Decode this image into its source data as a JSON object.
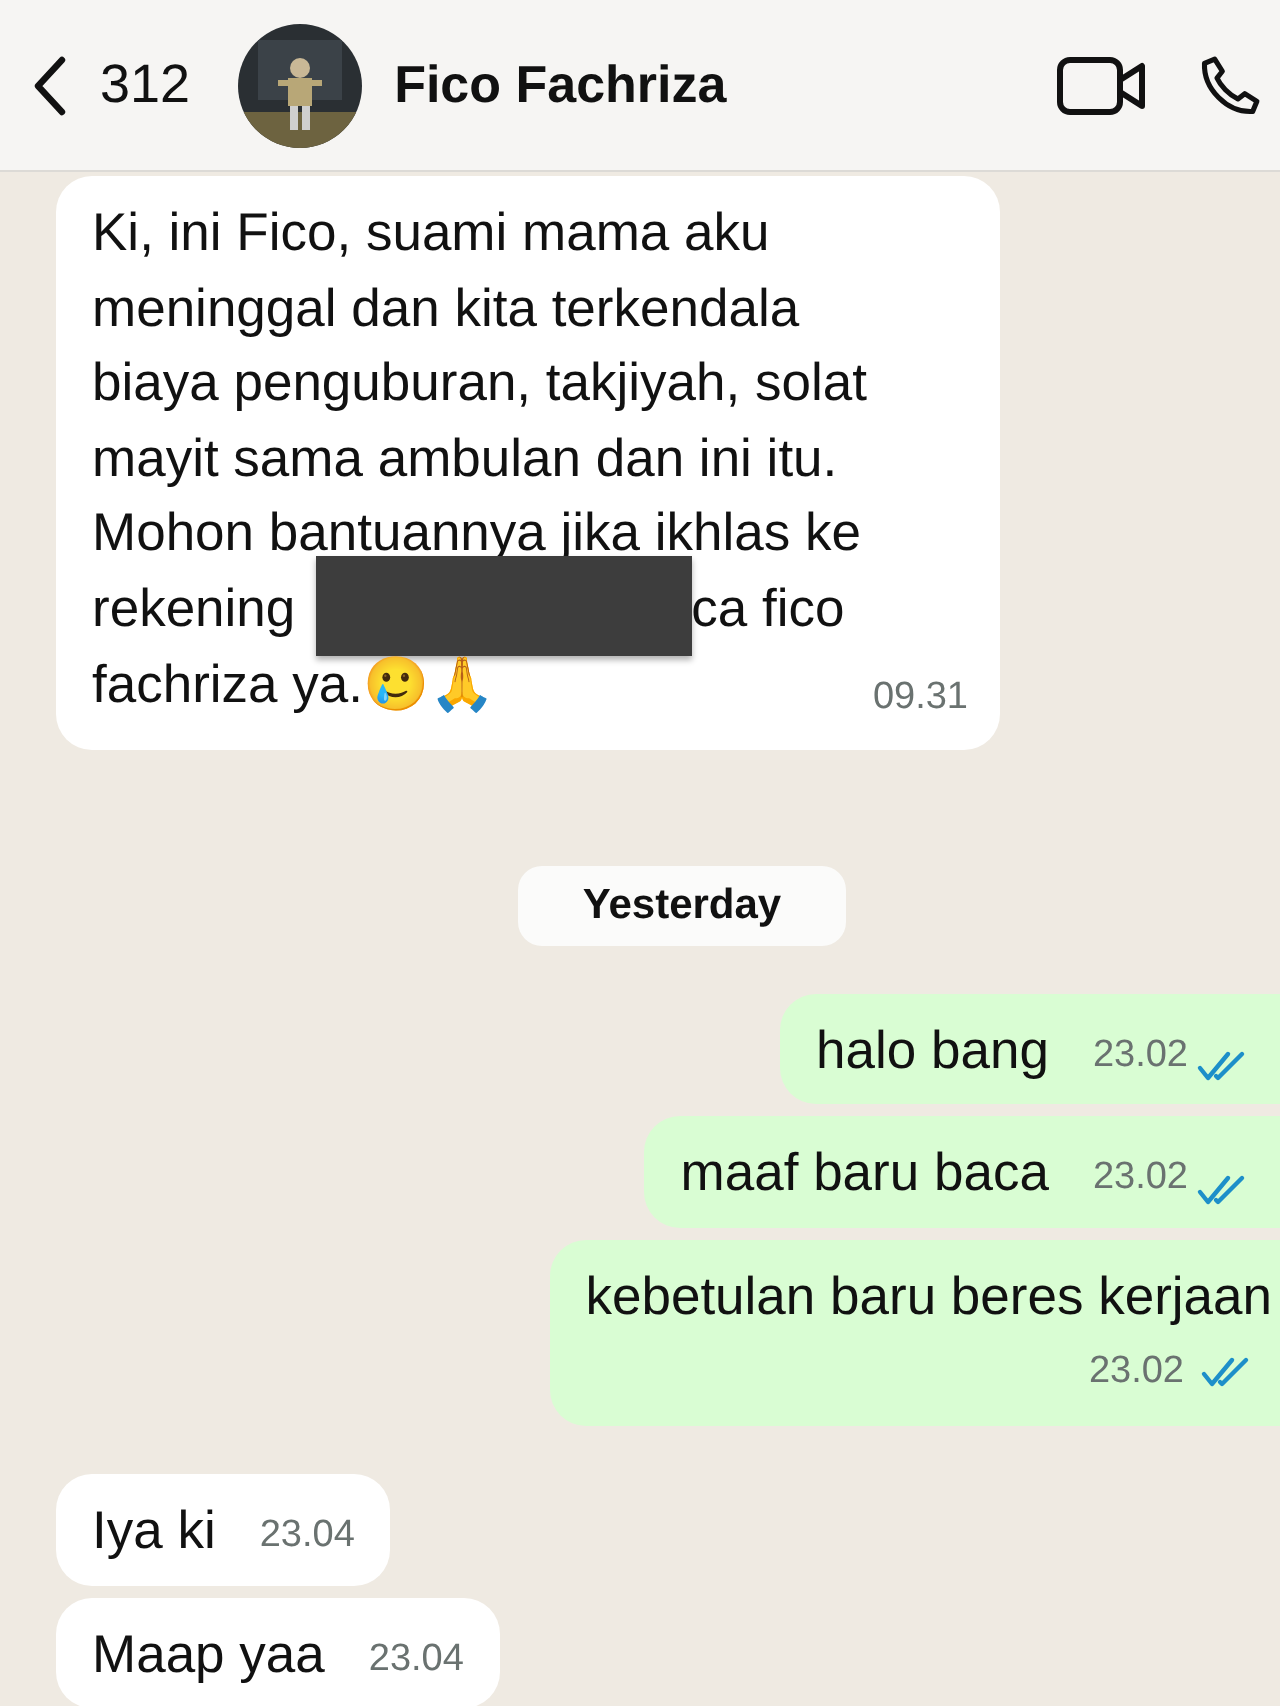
{
  "header": {
    "back_count": "312",
    "contact_name": "Fico Fachriza"
  },
  "chat": [
    {
      "kind": "incoming",
      "lines": [
        {
          "text": "Ki, ini Fico, suami mama aku"
        },
        {
          "text": "meninggal dan kita terkendala"
        },
        {
          "text": "biaya penguburan, takjiyah, solat"
        },
        {
          "text": "mayit sama ambulan dan ini itu."
        },
        {
          "text": "Mohon bantuannya jika ikhlas ke"
        },
        {
          "text": "rekening",
          "redacted": true,
          "tail": "ca fico"
        },
        {
          "text": "fachriza ya.🥲🙏"
        }
      ],
      "time": "09.31"
    },
    {
      "kind": "date_chip",
      "text": "Yesterday"
    },
    {
      "kind": "outgoing",
      "lines": [
        {
          "text": "halo bang"
        }
      ],
      "time": "23.02",
      "read": true
    },
    {
      "kind": "outgoing",
      "lines": [
        {
          "text": "maaf baru baca"
        }
      ],
      "time": "23.02",
      "read": true
    },
    {
      "kind": "outgoing",
      "lines": [
        {
          "text": "kebetulan baru beres kerjaan"
        }
      ],
      "time": "23.02",
      "read": true
    },
    {
      "kind": "incoming",
      "lines": [
        {
          "text": "Iya ki"
        }
      ],
      "time": "23.04"
    },
    {
      "kind": "incoming",
      "lines": [
        {
          "text": "Maap yaa"
        }
      ],
      "time": "23.04"
    }
  ]
}
